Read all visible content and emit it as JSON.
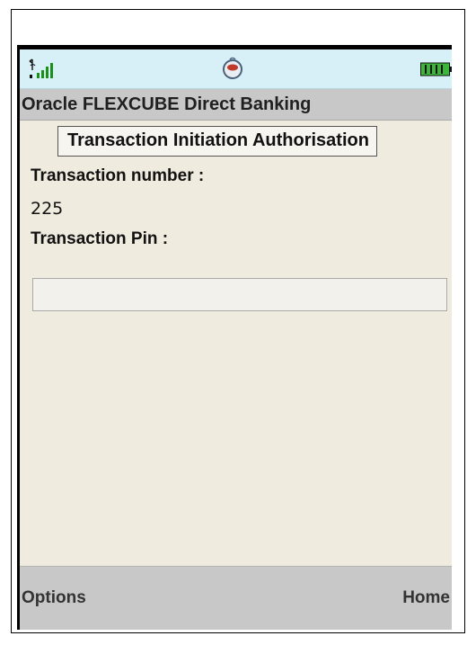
{
  "status_bar": {
    "signal_icon": "signal-strength-icon",
    "center_icon": "java-coffee-cup-icon",
    "battery_icon": "battery-icon"
  },
  "app": {
    "title": "Oracle FLEXCUBE Direct Banking"
  },
  "form": {
    "heading": "Transaction Initiation Authorisation",
    "transaction_number_label": "Transaction number :",
    "transaction_number_value": "225",
    "transaction_pin_label": "Transaction Pin :",
    "transaction_pin_value": ""
  },
  "softkeys": {
    "left": "Options",
    "right": "Home"
  },
  "colors": {
    "status_bar_bg": "#d7f0f8",
    "title_bar_bg": "#c8c8c8",
    "screen_bg": "#efebde",
    "battery_green": "#3bb63b"
  }
}
